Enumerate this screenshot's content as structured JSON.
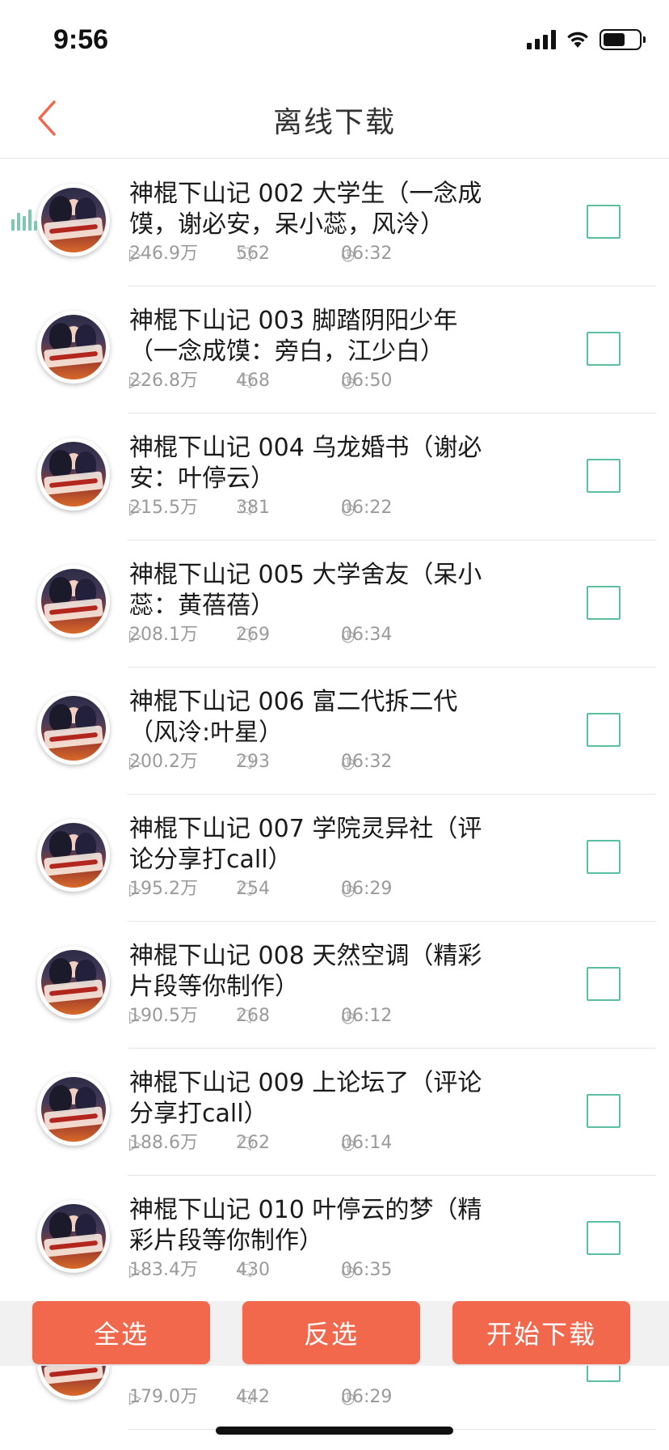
{
  "status_bar": {
    "time": "9:56"
  },
  "nav": {
    "title": "离线下载"
  },
  "episodes": [
    {
      "title": "神棍下山记 002 大学生（一念成馍，谢必安，呆小蕊，风泠）",
      "plays": "246.9万",
      "comments": "562",
      "duration": "06:32",
      "playing": true
    },
    {
      "title": "神棍下山记 003 脚踏阴阳少年（一念成馍：旁白，江少白）",
      "plays": "226.8万",
      "comments": "468",
      "duration": "06:50"
    },
    {
      "title": "神棍下山记 004 乌龙婚书（谢必安：叶停云）",
      "plays": "215.5万",
      "comments": "381",
      "duration": "06:22"
    },
    {
      "title": "神棍下山记 005 大学舍友（呆小蕊：黄蓓蓓）",
      "plays": "208.1万",
      "comments": "269",
      "duration": "06:34"
    },
    {
      "title": "神棍下山记 006 富二代拆二代（风泠:叶星）",
      "plays": "200.2万",
      "comments": "293",
      "duration": "06:32"
    },
    {
      "title": "神棍下山记 007 学院灵异社（评论分享打call）",
      "plays": "195.2万",
      "comments": "254",
      "duration": "06:29"
    },
    {
      "title": "神棍下山记 008 天然空调（精彩片段等你制作）",
      "plays": "190.5万",
      "comments": "268",
      "duration": "06:12"
    },
    {
      "title": "神棍下山记 009 上论坛了（评论分享打call）",
      "plays": "188.6万",
      "comments": "262",
      "duration": "06:14"
    },
    {
      "title": "神棍下山记 010 叶停云的梦（精彩片段等你制作）",
      "plays": "183.4万",
      "comments": "430",
      "duration": "06:35"
    },
    {
      "title": "",
      "plays": "179.0万",
      "comments": "442",
      "duration": "06:29"
    }
  ],
  "actions": {
    "select_all": "全选",
    "invert": "反选",
    "start_download": "开始下载"
  },
  "colors": {
    "accent": "#f1684d",
    "checkbox": "#5cbfa2",
    "playing_indicator": "#7fc7b2"
  }
}
